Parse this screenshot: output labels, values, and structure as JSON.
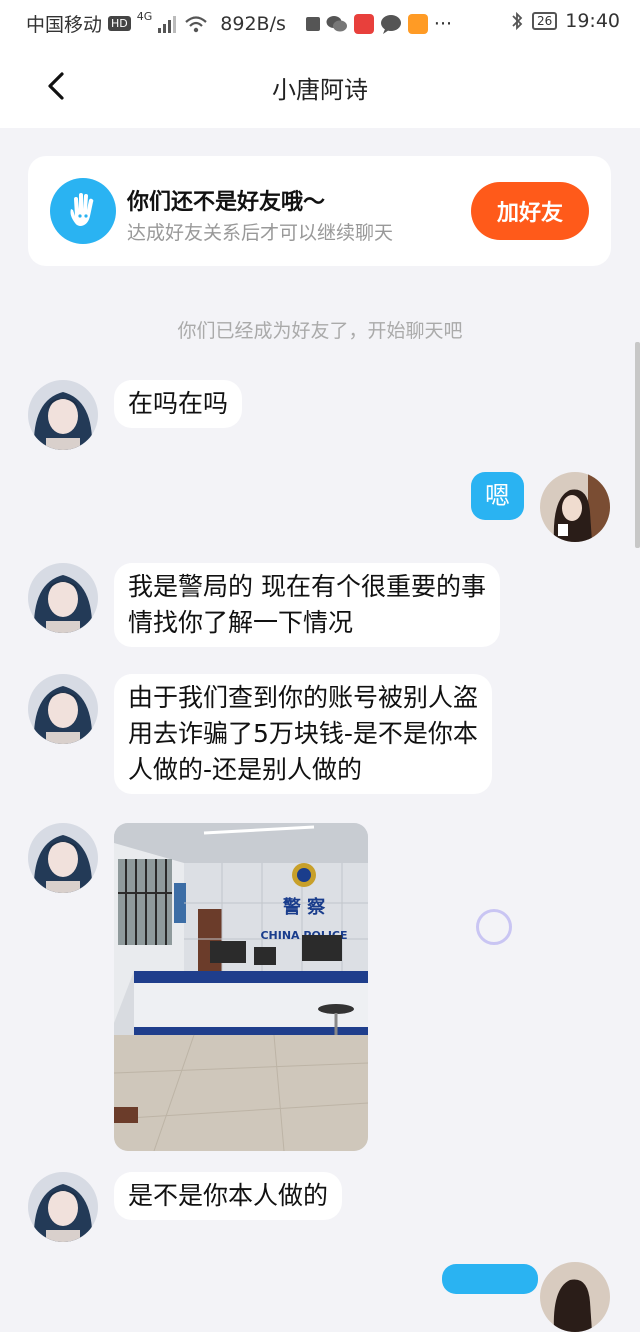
{
  "statusbar": {
    "carrier": "中国移动",
    "hd": "HD",
    "network": "4G",
    "speed": "892B/s",
    "more": "···",
    "battery": "26",
    "time": "19:40",
    "icons": [
      "signal-icon",
      "wifi-icon",
      "stop-icon",
      "wechat-icon",
      "huawei-icon",
      "message-icon",
      "video-icon",
      "bluetooth-icon",
      "battery-icon"
    ]
  },
  "header": {
    "back_icon": "chevron-left-icon",
    "title": "小唐阿诗"
  },
  "friend_card": {
    "title": "你们还不是好友哦～",
    "subtitle": "达成好友关系后才可以继续聊天",
    "button": "加好友",
    "accent": "#ff5a1a",
    "icon_bg": "#2ab3f2"
  },
  "system_message": "你们已经成为好友了，开始聊天吧",
  "messages": [
    {
      "side": "left",
      "text": "在吗在吗"
    },
    {
      "side": "right",
      "text": "嗯"
    },
    {
      "side": "left",
      "lines": [
        "我是警局的 现在有个很重要的事",
        "情找你了解一下情况"
      ]
    },
    {
      "side": "left",
      "lines": [
        "由于我们查到你的账号被别人盗",
        "用去诈骗了5万块钱-是不是你本",
        "人做的-还是别人做的"
      ]
    },
    {
      "side": "left",
      "type": "image",
      "sign_text": "警 察",
      "sign_en": "CHINA POLICE"
    },
    {
      "side": "left",
      "text": "是不是你本人做的"
    }
  ],
  "colors": {
    "my_bubble": "#2ab3f2",
    "background": "#f3f3f7"
  }
}
